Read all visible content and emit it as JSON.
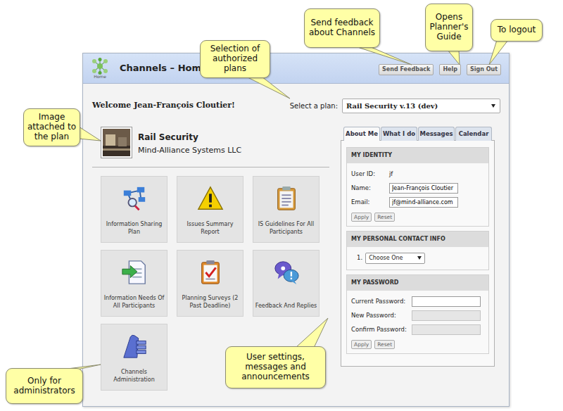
{
  "window": {
    "title": "Channels – Home",
    "logo_caption": "Home"
  },
  "header_buttons": [
    {
      "label": "Send Feedback"
    },
    {
      "label": "Help"
    },
    {
      "label": "Sign Out"
    }
  ],
  "welcome": "Welcome Jean-François Cloutier!",
  "plan_selector": {
    "label": "Select a plan:",
    "value": "Rail Security v.13 (dev)"
  },
  "plan": {
    "name": "Rail Security",
    "organization": "Mind-Alliance Systems LLC"
  },
  "tiles": [
    {
      "label": "Information Sharing Plan",
      "kind": "sharing"
    },
    {
      "label": "Issues Summary Report",
      "kind": "issues"
    },
    {
      "label": "IS Guidelines For All Participants",
      "kind": "guidelines"
    },
    {
      "label": "Information Needs Of All Participants",
      "kind": "needs"
    },
    {
      "label": "Planning Surveys (2 Past Deadline)",
      "kind": "surveys"
    },
    {
      "label": "Feedback And Replies",
      "kind": "feedback"
    },
    {
      "label": "Channels Administration",
      "kind": "admin"
    }
  ],
  "tabs": [
    {
      "label": "About Me",
      "selected": true
    },
    {
      "label": "What I do",
      "selected": false
    },
    {
      "label": "Messages",
      "selected": false
    },
    {
      "label": "Calendar",
      "selected": false
    }
  ],
  "identity": {
    "title": "MY IDENTITY",
    "fields": [
      {
        "label": "User ID:",
        "value": "jf",
        "kind": "text"
      },
      {
        "label": "Name:",
        "value": "Jean-François Cloutier",
        "kind": "input"
      },
      {
        "label": "Email:",
        "value": "jf@mind-alliance.com",
        "kind": "input"
      }
    ],
    "buttons": [
      "Apply",
      "Reset"
    ]
  },
  "contact_info": {
    "title": "MY PERSONAL CONTACT INFO",
    "items": [
      {
        "number": "1.",
        "value": "Choose One"
      }
    ]
  },
  "password": {
    "title": "MY PASSWORD",
    "fields": [
      {
        "label": "Current Password:",
        "disabled": false
      },
      {
        "label": "New Password:",
        "disabled": true
      },
      {
        "label": "Confirm Password:",
        "disabled": true
      }
    ],
    "buttons": [
      "Apply",
      "Reset"
    ]
  },
  "callouts": [
    "Send feedback about Channels",
    "Opens Planner's Guide",
    "To logout",
    "Selection of authorized plans",
    "Image attached to the plan",
    "Only for administrators",
    "User settings, messages and announcements"
  ]
}
